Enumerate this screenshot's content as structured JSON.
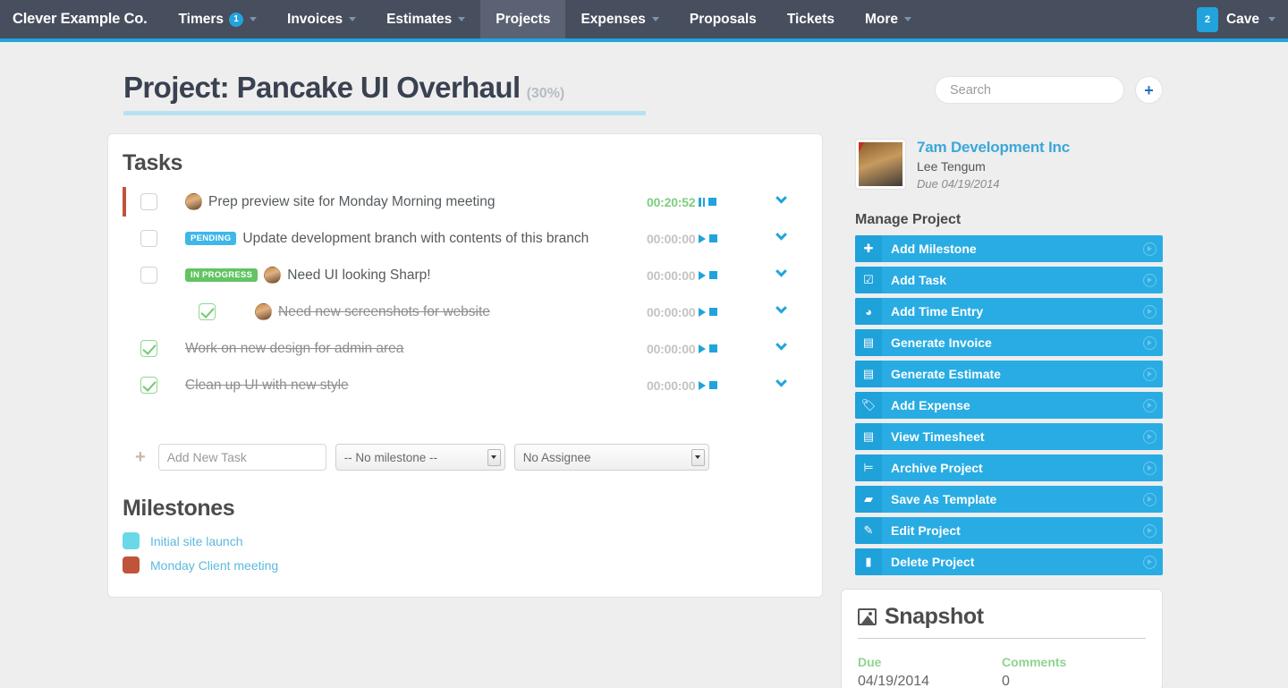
{
  "navbar": {
    "brand": "Clever Example Co.",
    "items": [
      {
        "label": "Timers",
        "badge": "1",
        "caret": true,
        "active": false
      },
      {
        "label": "Invoices",
        "badge": "",
        "caret": true,
        "active": false
      },
      {
        "label": "Estimates",
        "badge": "",
        "caret": true,
        "active": false
      },
      {
        "label": "Projects",
        "badge": "",
        "caret": false,
        "active": true
      },
      {
        "label": "Expenses",
        "badge": "",
        "caret": true,
        "active": false
      },
      {
        "label": "Proposals",
        "badge": "",
        "caret": false,
        "active": false
      },
      {
        "label": "Tickets",
        "badge": "",
        "caret": false,
        "active": false
      },
      {
        "label": "More",
        "badge": "",
        "caret": true,
        "active": false
      }
    ],
    "user_count": "2",
    "user_name": "Cave"
  },
  "header": {
    "title": "Project: Pancake UI Overhaul",
    "percent": "(30%)",
    "search_placeholder": "Search",
    "search_value": "",
    "add_label": "+"
  },
  "tasks_card": {
    "title": "Tasks",
    "rows": [
      {
        "label": "Prep preview site for Monday Morning meeting",
        "checked": false,
        "done": false,
        "sub": false,
        "avatar": true,
        "tag": "",
        "tag_type": "",
        "milestone_marker": true,
        "time": "00:20:52",
        "running": true,
        "control": "pause"
      },
      {
        "label": "Update development branch with contents of this branch",
        "checked": false,
        "done": false,
        "sub": false,
        "avatar": false,
        "tag": "PENDING",
        "tag_type": "pending",
        "milestone_marker": false,
        "time": "00:00:00",
        "running": false,
        "control": "play"
      },
      {
        "label": "Need UI looking Sharp!",
        "checked": false,
        "done": false,
        "sub": false,
        "avatar": true,
        "tag": "IN PROGRESS",
        "tag_type": "progress",
        "milestone_marker": false,
        "time": "00:00:00",
        "running": false,
        "control": "play"
      },
      {
        "label": "Need new screenshots for website",
        "checked": true,
        "done": true,
        "sub": true,
        "avatar": true,
        "tag": "",
        "tag_type": "",
        "milestone_marker": false,
        "time": "00:00:00",
        "running": false,
        "control": "play"
      },
      {
        "label": "Work on new design for admin area",
        "checked": true,
        "done": true,
        "sub": false,
        "avatar": false,
        "tag": "",
        "tag_type": "",
        "milestone_marker": false,
        "time": "00:00:00",
        "running": false,
        "control": "play"
      },
      {
        "label": "Clean up UI with new style",
        "checked": true,
        "done": true,
        "sub": false,
        "avatar": false,
        "tag": "",
        "tag_type": "",
        "milestone_marker": false,
        "time": "00:00:00",
        "running": false,
        "control": "play"
      }
    ],
    "add_form": {
      "plus": "+",
      "task_placeholder": "Add New Task",
      "task_value": "",
      "milestone_selected": "-- No milestone --",
      "assignee_selected": "No Assignee"
    },
    "milestones_title": "Milestones",
    "milestones": [
      {
        "name": "Initial site launch",
        "color": "#69d9e8"
      },
      {
        "name": "Monday Client meeting",
        "color": "#c0543a"
      }
    ]
  },
  "sidebar": {
    "client_name": "7am Development Inc",
    "client_contact": "Lee Tengum",
    "client_due": "Due 04/19/2014",
    "manage_title": "Manage Project",
    "actions": [
      {
        "label": "Add Milestone",
        "icon": "plus-icon",
        "glyph": "✚"
      },
      {
        "label": "Add Task",
        "icon": "task-check-icon",
        "glyph": "☑"
      },
      {
        "label": "Add Time Entry",
        "icon": "clock-icon",
        "glyph": "◕"
      },
      {
        "label": "Generate Invoice",
        "icon": "document-icon",
        "glyph": "▤"
      },
      {
        "label": "Generate Estimate",
        "icon": "document-icon",
        "glyph": "▤"
      },
      {
        "label": "Add Expense",
        "icon": "tag-icon",
        "glyph": "🏷"
      },
      {
        "label": "View Timesheet",
        "icon": "document-icon",
        "glyph": "▤"
      },
      {
        "label": "Archive Project",
        "icon": "archive-icon",
        "glyph": "⊨"
      },
      {
        "label": "Save As Template",
        "icon": "folder-icon",
        "glyph": "▰"
      },
      {
        "label": "Edit Project",
        "icon": "pencil-icon",
        "glyph": "✎"
      },
      {
        "label": "Delete Project",
        "icon": "trash-icon",
        "glyph": "▮"
      }
    ]
  },
  "snapshot": {
    "title": "Snapshot",
    "cells": [
      {
        "label": "Due",
        "value": "04/19/2014"
      },
      {
        "label": "Comments",
        "value": "0"
      }
    ]
  }
}
